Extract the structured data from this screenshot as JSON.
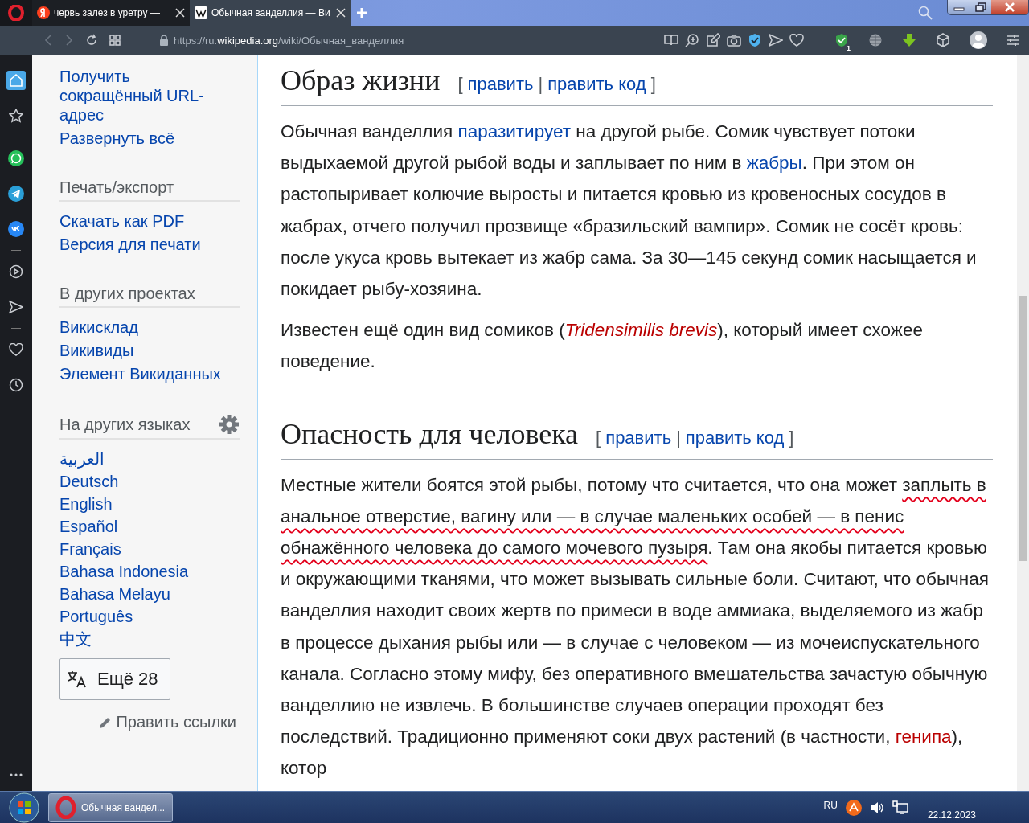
{
  "browser": {
    "tabs": [
      {
        "title": "червь залез в уретру —",
        "kind": "yandex",
        "selected": false
      },
      {
        "title": "Обычная ванделлия — Ви",
        "kind": "wiki",
        "selected": true
      }
    ],
    "url": "https://ru.**wikipedia.org**/wiki/Обычная_ванделлия",
    "extension_badge": "1"
  },
  "opera_sidebar": {
    "items": [
      {
        "kind": "home",
        "selected": true
      },
      {
        "kind": "star",
        "selected": false
      },
      {
        "kind": "divider"
      },
      {
        "kind": "whatsapp",
        "selected": false
      },
      {
        "kind": "telegram",
        "selected": false
      },
      {
        "kind": "vk",
        "selected": false
      },
      {
        "kind": "divider"
      },
      {
        "kind": "player",
        "selected": false
      },
      {
        "kind": "send",
        "selected": false
      },
      {
        "kind": "divider"
      },
      {
        "kind": "heart",
        "selected": false
      },
      {
        "kind": "history",
        "selected": false
      }
    ]
  },
  "wiki_panel": {
    "top_links": [
      "Получить сокращённый URL-адрес",
      "Развернуть всё"
    ],
    "sections": [
      {
        "heading": "Печать/экспорт",
        "settings": false,
        "links": [
          "Скачать как PDF",
          "Версия для печати"
        ]
      },
      {
        "heading": "В других проектах",
        "settings": false,
        "links": [
          "Викисклад",
          "Викивиды",
          "Элемент Викиданных"
        ]
      },
      {
        "heading": "На других языках",
        "settings": true,
        "links": [
          "العربية",
          "Deutsch",
          "English",
          "Español",
          "Français",
          "Bahasa Indonesia",
          "Bahasa Melayu",
          "Português",
          "中文"
        ]
      }
    ],
    "more_languages": "Ещё 28",
    "edit_links": "Править ссылки"
  },
  "article": {
    "sections": [
      {
        "heading": "Образ жизни",
        "edit": {
          "open": "[",
          "links": [
            "править",
            "править код"
          ],
          "separator": "|",
          "close": "]"
        },
        "paragraphs": [
          [
            {
              "kind": "text",
              "text": "Обычная ванделлия "
            },
            {
              "kind": "link",
              "text": "паразитирует"
            },
            {
              "kind": "text",
              "text": " на другой рыбе. Сомик чувствует потоки выдыхаемой другой рыбой воды и заплывает по ним в "
            },
            {
              "kind": "link",
              "text": "жабры"
            },
            {
              "kind": "text",
              "text": ". При этом он растопыривает колючие выросты и питается кровью из кровеносных сосудов в жабрах, отчего получил прозвище «бразильский вампир». Сомик не сосёт кровь: после укуса кровь вытекает из жабр сама. За 30—145 секунд сомик насыщается и покидает рыбу-хозяина."
            }
          ],
          [
            {
              "kind": "text",
              "text": "Известен ещё один вид сомиков ("
            },
            {
              "kind": "redlink-italic",
              "text": "Tridensimilis brevis"
            },
            {
              "kind": "text",
              "text": "), который имеет схожее поведение."
            }
          ]
        ]
      },
      {
        "heading": "Опасность для человека",
        "edit": {
          "open": "[",
          "links": [
            "править",
            "править код"
          ],
          "separator": "|",
          "close": "]"
        },
        "paragraphs": [
          [
            {
              "kind": "text",
              "text": "Местные жители боятся этой рыбы, потому что считается, что она может "
            },
            {
              "kind": "underlined",
              "text": "заплыть в анальное отверстие, вагину или — в случае маленьких особей — в пенис обнажённого человека до самого мочевого пузыря"
            },
            {
              "kind": "text",
              "text": ". Там она якобы питается кровью и окружающими тканями, что может вызывать сильные боли. Считают, что обычная ванделлия находит своих жертв по примеси в воде аммиака, выделяемого из жабр в процессе дыхания рыбы или — в случае с человеком — из мочеиспускательного канала. Согласно этому мифу, без оперативного вмешательства зачастую обычную ванделлию не извлечь. В большинстве случаев операции проходят без последствий. Традиционно применяют соки двух растений (в частности, "
            },
            {
              "kind": "redlink",
              "text": "генипа"
            },
            {
              "kind": "text",
              "text": "), котор"
            }
          ]
        ]
      }
    ]
  },
  "taskbar": {
    "window_title": "Обычная вандел...",
    "language": "RU",
    "date": "22.12.2023"
  }
}
